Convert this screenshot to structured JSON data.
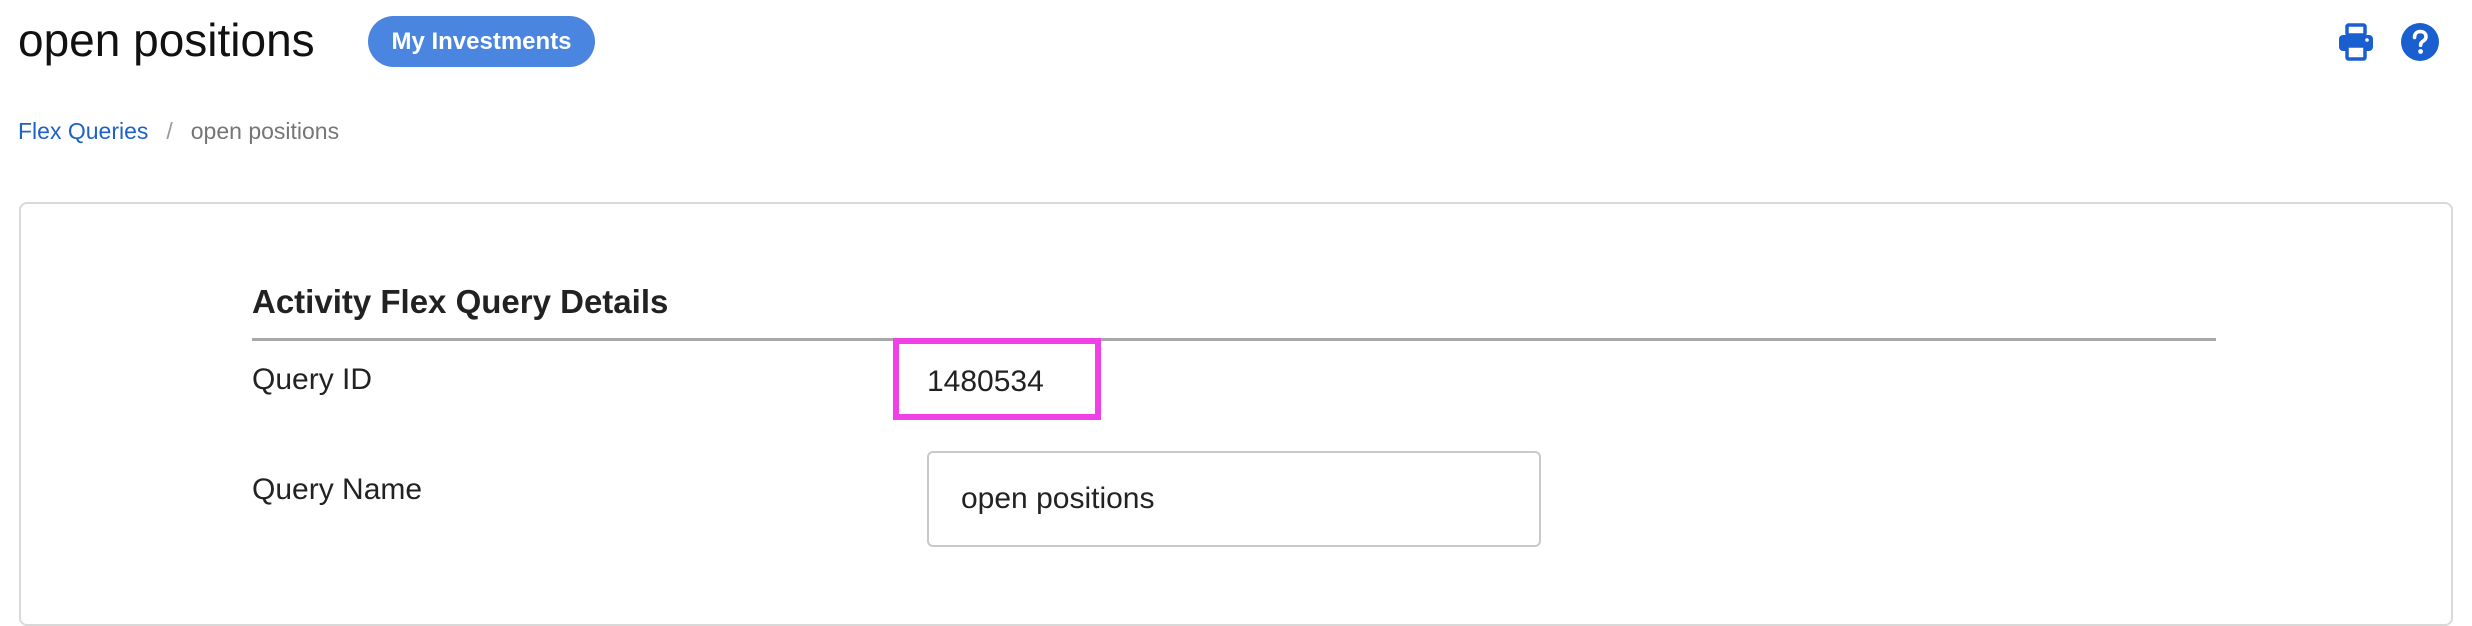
{
  "header": {
    "title": "open positions",
    "badge_label": "My Investments",
    "icons": [
      "printer-icon",
      "help-icon"
    ],
    "accent_color": "#4a86e0",
    "icon_color": "#1a5fd0"
  },
  "breadcrumb": {
    "items": [
      {
        "label": "Flex Queries",
        "link": true
      },
      {
        "label": "open positions",
        "link": false
      }
    ],
    "separator": "/"
  },
  "details": {
    "section_title": "Activity Flex Query Details",
    "fields": [
      {
        "label": "Query ID",
        "value": "1480534"
      },
      {
        "label": "Query Name",
        "value": "open positions"
      }
    ],
    "highlight_color": "#f041e6"
  }
}
